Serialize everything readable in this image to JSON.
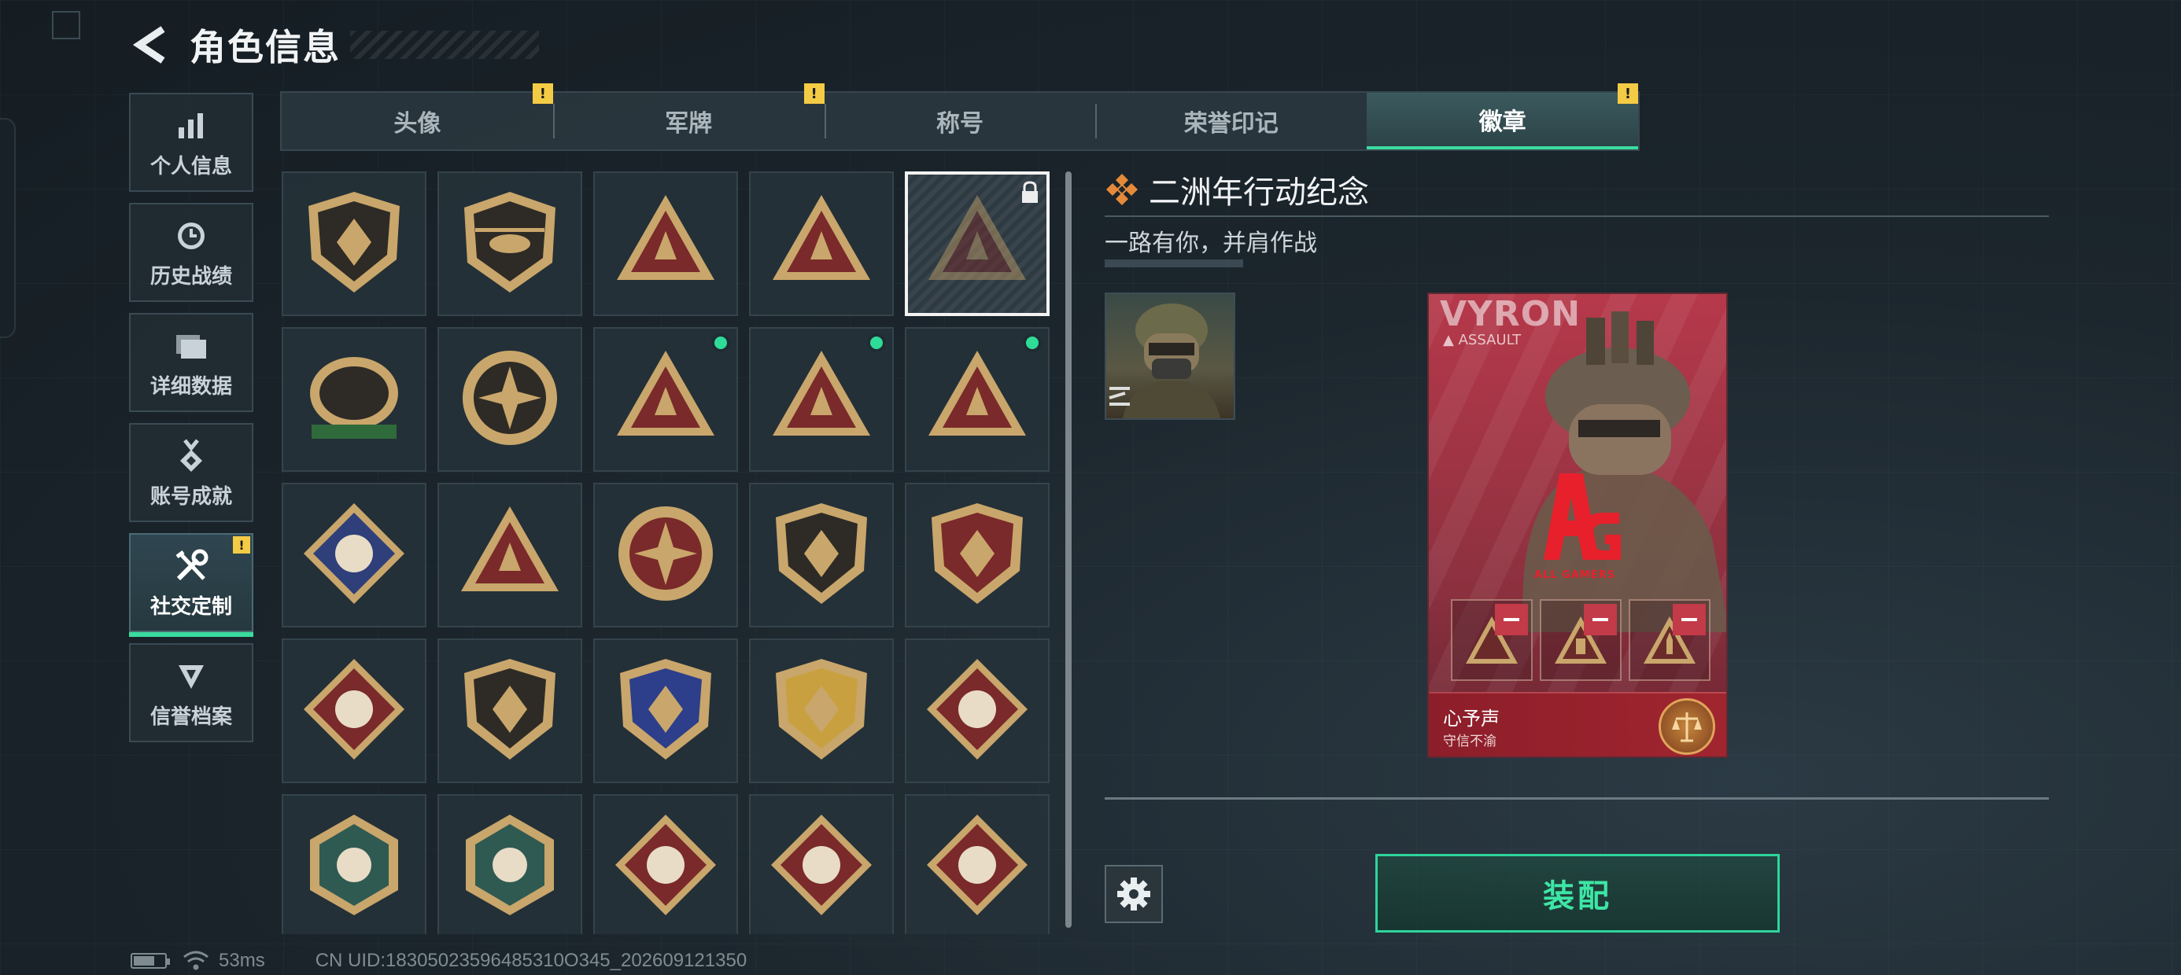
{
  "header": {
    "title": "角色信息"
  },
  "side_nav": {
    "items": [
      {
        "label": "个人信息",
        "icon": "bar-chart-icon",
        "active": false,
        "alert": false
      },
      {
        "label": "历史战绩",
        "icon": "clock-history-icon",
        "active": false,
        "alert": false
      },
      {
        "label": "详细数据",
        "icon": "folder-icon",
        "active": false,
        "alert": false
      },
      {
        "label": "账号成就",
        "icon": "achievement-medal-icon",
        "active": false,
        "alert": false
      },
      {
        "label": "社交定制",
        "icon": "tools-icon",
        "active": true,
        "alert": true
      },
      {
        "label": "信誉档案",
        "icon": "credit-shield-icon",
        "active": false,
        "alert": false
      }
    ],
    "alert_symbol": "!"
  },
  "tabs": [
    {
      "label": "头像",
      "alert": true,
      "active": false
    },
    {
      "label": "军牌",
      "alert": true,
      "active": false
    },
    {
      "label": "称号",
      "alert": false,
      "active": false
    },
    {
      "label": "荣誉印记",
      "alert": false,
      "active": false
    },
    {
      "label": "徽章",
      "alert": true,
      "active": true
    }
  ],
  "badges": [
    {
      "icon": "delta-shield-badge-icon",
      "new": false,
      "locked": false,
      "selected": false
    },
    {
      "icon": "helicopter-badge-icon",
      "new": false,
      "locked": false,
      "selected": false
    },
    {
      "icon": "feather-triangle-badge-icon",
      "new": false,
      "locked": false,
      "selected": false
    },
    {
      "icon": "anniversary-1-badge-icon",
      "new": false,
      "locked": false,
      "selected": false
    },
    {
      "icon": "anniversary-2-badge-icon",
      "new": false,
      "locked": true,
      "selected": true
    },
    {
      "icon": "delta-force-2026-banner-badge-icon",
      "new": false,
      "locked": false,
      "selected": false
    },
    {
      "icon": "delta-force-2026-globe-badge-icon",
      "new": false,
      "locked": false,
      "selected": false
    },
    {
      "icon": "usb-triangle-badge-icon",
      "new": true,
      "locked": false,
      "selected": false
    },
    {
      "icon": "soldiers-triangle-badge-icon",
      "new": true,
      "locked": false,
      "selected": false
    },
    {
      "icon": "rocket-triangle-badge-icon",
      "new": true,
      "locked": false,
      "selected": false
    },
    {
      "icon": "rose-diamond-badge-icon",
      "new": false,
      "locked": false,
      "selected": false
    },
    {
      "icon": "hazmat-triangle-badge-icon",
      "new": false,
      "locked": false,
      "selected": false
    },
    {
      "icon": "star-compass-badge-icon",
      "new": false,
      "locked": false,
      "selected": false
    },
    {
      "icon": "dark-shield-badge-icon",
      "new": false,
      "locked": false,
      "selected": false
    },
    {
      "icon": "stars-shield-badge-icon",
      "new": false,
      "locked": false,
      "selected": false
    },
    {
      "icon": "blue-diamond-shield-badge-icon",
      "new": false,
      "locked": false,
      "selected": false
    },
    {
      "icon": "rifle-shield-badge-icon",
      "new": false,
      "locked": false,
      "selected": false
    },
    {
      "icon": "crosshair-blue-badge-icon",
      "new": false,
      "locked": false,
      "selected": false
    },
    {
      "icon": "crosshair-gold-badge-icon",
      "new": false,
      "locked": false,
      "selected": false
    },
    {
      "icon": "wolf-diamond-badge-icon",
      "new": false,
      "locked": false,
      "selected": false
    },
    {
      "icon": "wasp-hexagon-badge-icon",
      "new": false,
      "locked": false,
      "selected": false
    },
    {
      "icon": "medic-hexagon-badge-icon",
      "new": false,
      "locked": false,
      "selected": false
    },
    {
      "icon": "dragon-diamond-badge-icon",
      "new": false,
      "locked": false,
      "selected": false
    },
    {
      "icon": "dragon-diamond-badge-icon",
      "new": false,
      "locked": false,
      "selected": false
    },
    {
      "icon": "runner-diamond-badge-icon",
      "new": false,
      "locked": false,
      "selected": false
    }
  ],
  "detail": {
    "title": "二洲年行动纪念",
    "subtitle": "一路有你，并肩作战",
    "card": {
      "operator_name": "VYRON",
      "operator_role": "ASSAULT",
      "team_logo_text": "AG",
      "team_logo_sub": "ALL GAMERS",
      "player_name": "心予声",
      "motto": "守信不渝",
      "emblem_icon": "scales-emblem-icon"
    },
    "equip_label": "装配"
  },
  "status_bar": {
    "ping": "53ms",
    "uid": "CN UID:18305023596485310O345_202609121350"
  },
  "colors": {
    "accent_green": "#3bdba0",
    "alert_yellow": "#f4cb45",
    "card_red": "#b6394a",
    "badge_gold": "#c9a66b",
    "badge_red": "#7a2a2a"
  }
}
